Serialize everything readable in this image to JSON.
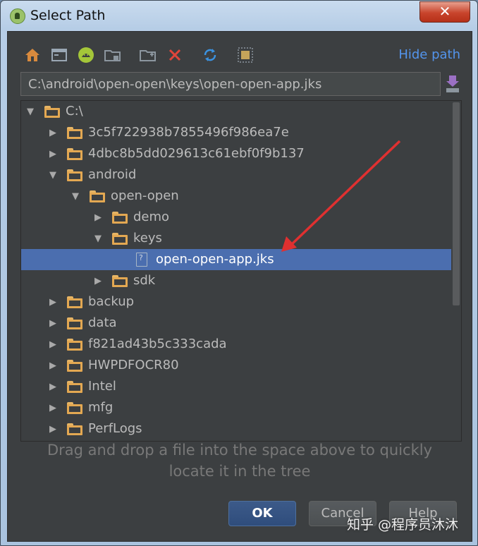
{
  "window": {
    "title": "Select Path",
    "close_label": "✕"
  },
  "toolbar": {
    "icons": [
      "home-icon",
      "desktop-icon",
      "android-project-icon",
      "module-folder-icon",
      "new-folder-icon",
      "delete-icon",
      "refresh-icon",
      "show-hidden-icon"
    ],
    "hide_path_label": "Hide path"
  },
  "path": {
    "value": "C:\\android\\open-open\\keys\\open-open-app.jks"
  },
  "tree": {
    "rows": [
      {
        "label": "C:\\",
        "expanded": true
      },
      {
        "label": "3c5f722938b7855496f986ea7e",
        "expanded": false
      },
      {
        "label": "4dbc8b5dd029613c61ebf0f9b137",
        "expanded": false
      },
      {
        "label": "android",
        "expanded": true
      },
      {
        "label": "open-open",
        "expanded": true
      },
      {
        "label": "demo",
        "expanded": false
      },
      {
        "label": "keys",
        "expanded": true
      },
      {
        "label": "open-open-app.jks",
        "selected": true
      },
      {
        "label": "sdk",
        "expanded": false
      },
      {
        "label": "backup",
        "expanded": false
      },
      {
        "label": "data",
        "expanded": false
      },
      {
        "label": "f821ad43b5c333cada",
        "expanded": false
      },
      {
        "label": "HWPDFOCR80",
        "expanded": false
      },
      {
        "label": "Intel",
        "expanded": false
      },
      {
        "label": "mfg",
        "expanded": false
      },
      {
        "label": "PerfLogs",
        "expanded": false
      }
    ]
  },
  "hint": {
    "line1": "Drag and drop a file into the space above to quickly",
    "line2": "locate it in the tree"
  },
  "buttons": {
    "ok": "OK",
    "cancel": "Cancel",
    "help": "Help"
  },
  "watermark": "知乎 @程序员沐沐",
  "colors": {
    "selection": "#4b6eaf",
    "link": "#5394ec",
    "folder": "#e3a852",
    "annotation_arrow": "#e03030"
  }
}
